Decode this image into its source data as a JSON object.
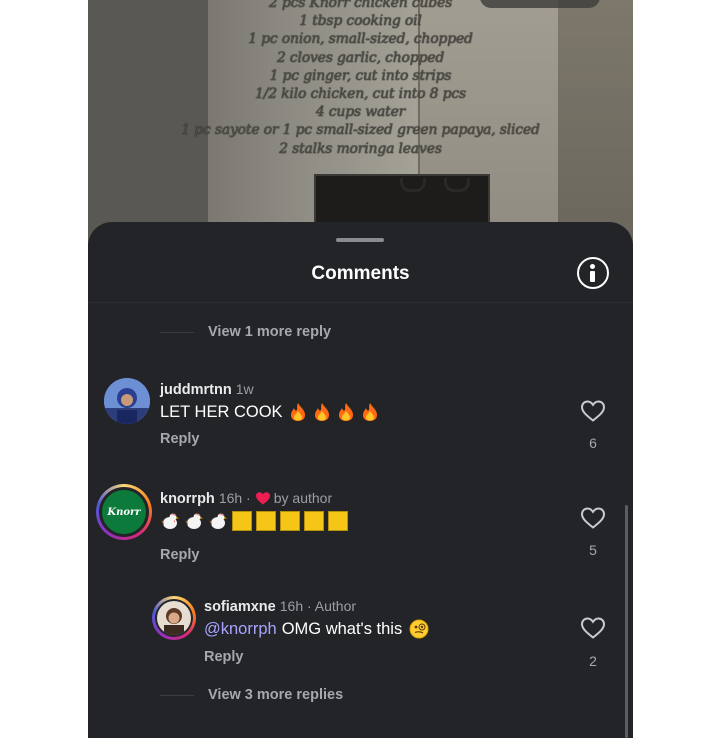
{
  "video": {
    "recipe_lines": [
      "2 pcs Knorr chicken cubes",
      "1 tbsp cooking oil",
      "1 pc onion, small-sized, chopped",
      "2 cloves garlic, chopped",
      "1 pc ginger, cut into strips",
      "1/2 kilo chicken, cut into 8 pcs",
      "4 cups water",
      "1 pc sayote or 1 pc small-sized green papaya, sliced",
      "2 stalks moringa leaves"
    ]
  },
  "sheet": {
    "title": "Comments",
    "view_more_top": "View 1 more reply",
    "view_more_bottom": "View 3 more replies"
  },
  "comments": [
    {
      "username": "juddmrtnn",
      "time": "1w",
      "text": "LET HER COOK",
      "reply_label": "Reply",
      "likes": "6"
    },
    {
      "username": "knorrph",
      "time": "16h",
      "by_author": "by author",
      "reply_label": "Reply",
      "likes": "5",
      "avatar_text": "Knorr"
    },
    {
      "username": "sofiamxne",
      "time": "16h",
      "badge": "Author",
      "mention": "@knorrph",
      "text": "OMG what's this",
      "reply_label": "Reply",
      "likes": "2"
    }
  ],
  "colors": {
    "sheet_bg": "#222427",
    "heart_red": "#ee1d52",
    "mention": "#a7a4ff",
    "knorr_green": "#0b7a3a"
  }
}
